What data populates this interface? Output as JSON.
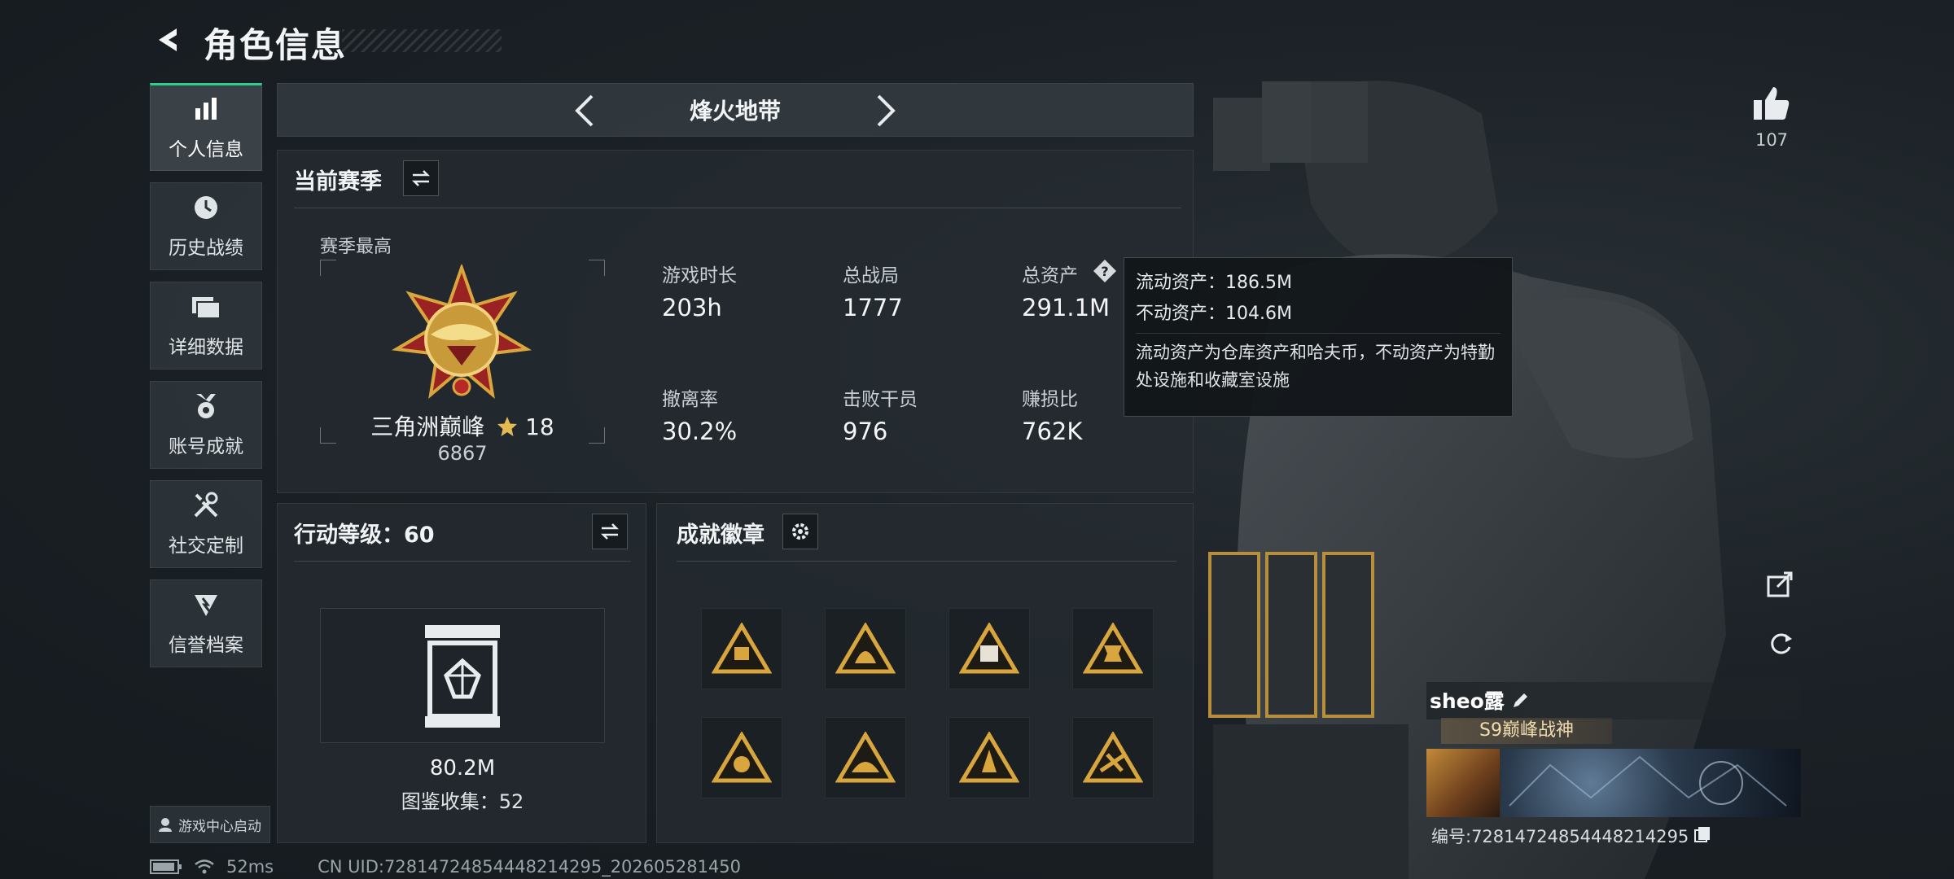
{
  "header": {
    "title": "角色信息"
  },
  "sidebar": {
    "items": [
      {
        "label": "个人信息",
        "icon": "bar-chart-icon",
        "active": true
      },
      {
        "label": "历史战绩",
        "icon": "clock-icon"
      },
      {
        "label": "详细数据",
        "icon": "folder-icon"
      },
      {
        "label": "账号成就",
        "icon": "medal-icon"
      },
      {
        "label": "社交定制",
        "icon": "tools-icon"
      },
      {
        "label": "信誉档案",
        "icon": "shield-icon"
      }
    ],
    "game_center": "游戏中心启动"
  },
  "mode": {
    "title": "烽火地带"
  },
  "season": {
    "title": "当前赛季",
    "best_label": "赛季最高",
    "rank_name": "三角洲巅峰",
    "rank_stars": "18",
    "rank_points": "6867",
    "stats": [
      {
        "label": "游戏时长",
        "value": "203h"
      },
      {
        "label": "总战局",
        "value": "1777"
      },
      {
        "label": "总资产",
        "value": "291.1M"
      },
      {
        "label": "撤离率",
        "value": "30.2%"
      },
      {
        "label": "击败干员",
        "value": "976"
      },
      {
        "label": "赚损比",
        "value": "762K"
      }
    ]
  },
  "tooltip": {
    "liquid": "流动资产：186.5M",
    "fixed": "不动资产：104.6M",
    "note": "流动资产为仓库资产和哈夫币，不动资产为特勤处设施和收藏室设施"
  },
  "action_level": {
    "title": "行动等级：60",
    "value": "80.2M",
    "collection": "图鉴收集：52"
  },
  "badges": {
    "title": "成就徽章",
    "count": 8
  },
  "profile": {
    "likes": "107",
    "name": "sheo露",
    "title_banner": "S9巅峰战神",
    "uid_line": "编号:72814724854448214295"
  },
  "status": {
    "ping": "52ms",
    "uid": "CN UID:72814724854448214295_202605281450"
  },
  "colors": {
    "accent": "#2bd18a",
    "gold": "#d8a63c",
    "panel": "#242b31"
  }
}
